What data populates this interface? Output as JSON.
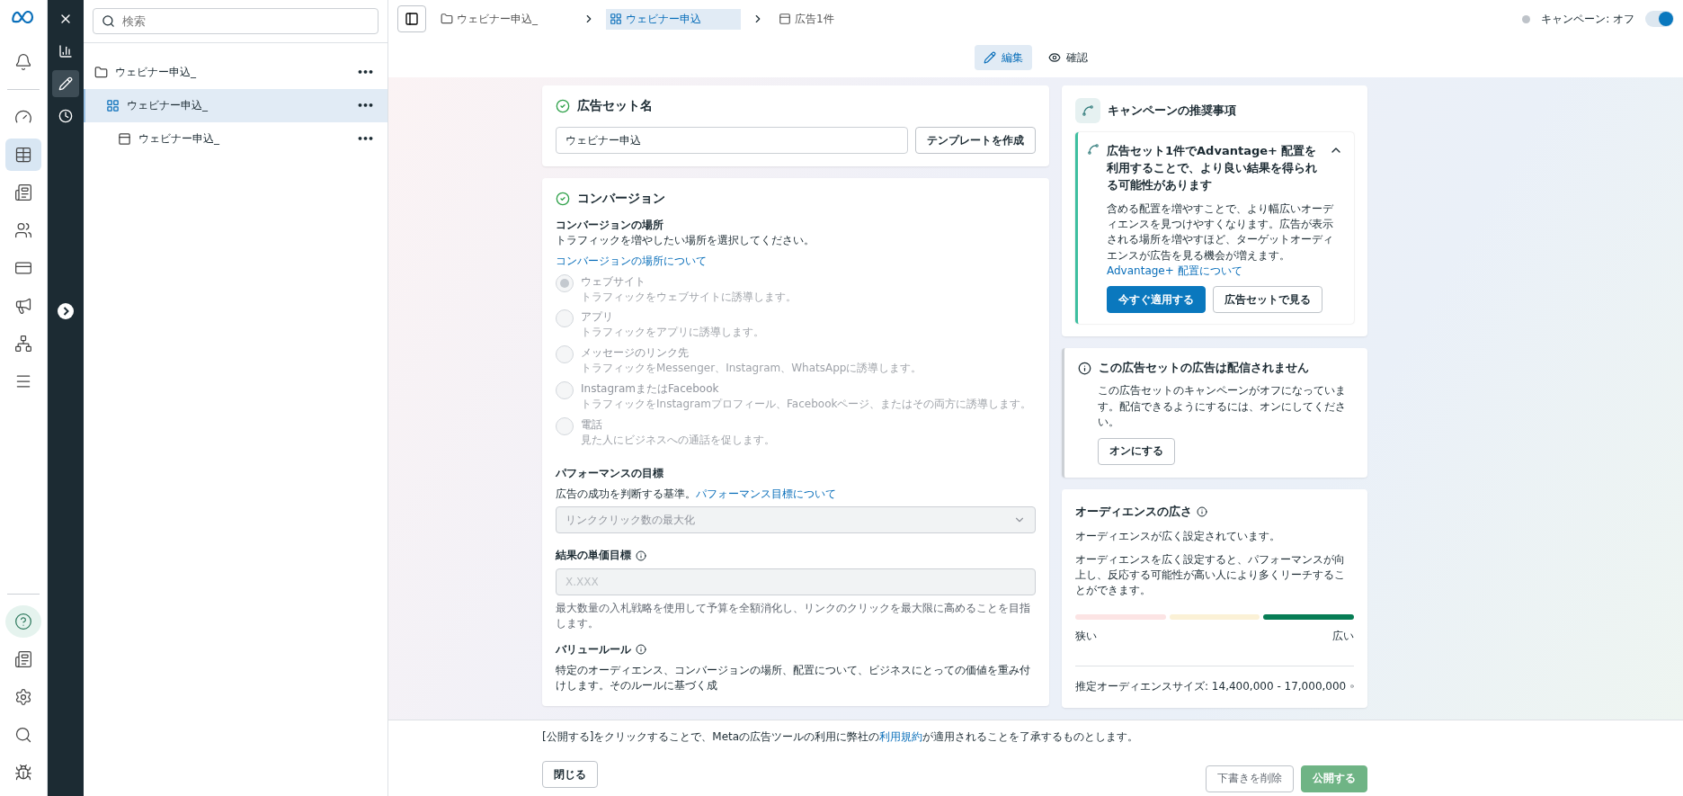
{
  "left_rail": {
    "main": [
      {
        "selected": false
      },
      {
        "selected": true
      },
      {
        "selected": false
      },
      {
        "selected": false
      },
      {
        "selected": false
      },
      {
        "selected": false
      },
      {
        "selected": false
      },
      {
        "selected": false
      }
    ],
    "bottom": [
      {
        "selected": true
      },
      {
        "selected": false
      },
      {
        "selected": false
      },
      {
        "selected": false
      },
      {
        "selected": false
      }
    ]
  },
  "tool_rail": [
    {
      "selected": false
    },
    {
      "selected": false
    },
    {
      "selected": true
    },
    {
      "selected": false
    }
  ],
  "tree": {
    "search": {
      "placeholder": "検索"
    },
    "items": [
      {
        "kind": "campaign",
        "label": "ウェビナー申込_",
        "more": "•••",
        "selected": false,
        "children": [
          {
            "kind": "adset",
            "label": "ウェビナー申込_",
            "more": "•••",
            "selected": true,
            "children": [
              {
                "kind": "ad",
                "label": "ウェビナー申込_",
                "more": "•••",
                "selected": false
              }
            ]
          }
        ]
      }
    ]
  },
  "breadcrumbs": [
    {
      "kind": "campaign",
      "label": "ウェビナー申込_",
      "selected": false
    },
    {
      "kind": "adset",
      "label": "ウェビナー申込",
      "selected": true
    },
    {
      "kind": "ad",
      "label": "広告1件",
      "selected": false
    }
  ],
  "campaign_toggle": {
    "label": "キャンペーン: オフ",
    "on": true
  },
  "tabs": [
    {
      "kind": "edit",
      "label": "編集",
      "selected": true
    },
    {
      "kind": "review",
      "label": "確認",
      "selected": false
    }
  ],
  "adset_name": {
    "title": "広告セット名",
    "value": "ウェビナー申込",
    "button": "テンプレートを作成"
  },
  "conversion": {
    "title": "コンバージョン",
    "location_title": "コンバージョンの場所",
    "location_hint": "トラフィックを増やしたい場所を選択してください。",
    "location_link": "コンバージョンの場所について",
    "options": [
      {
        "label": "ウェブサイト",
        "hint": "トラフィックをウェブサイトに誘導します。",
        "selected": true,
        "disabled": true
      },
      {
        "label": "アプリ",
        "hint": "トラフィックをアプリに誘導します。",
        "selected": false,
        "disabled": true
      },
      {
        "label": "メッセージのリンク先",
        "hint": "トラフィックをMessenger、Instagram、WhatsAppに誘導します。",
        "selected": false,
        "disabled": true
      },
      {
        "label": "InstagramまたはFacebook",
        "hint": "トラフィックをInstagramプロフィール、Facebookページ、またはその両方に誘導します。",
        "selected": false,
        "disabled": true
      },
      {
        "label": "電話",
        "hint": "見た人にビジネスへの通話を促します。",
        "selected": false,
        "disabled": true
      }
    ],
    "goal_title": "パフォーマンスの目標",
    "goal_hint": "広告の成功を判断する基準。",
    "goal_link": "パフォーマンス目標について",
    "goal_value": "リンククリック数の最大化",
    "cost_title": "結果の単価目標",
    "cost_placeholder": "X.XXX",
    "cost_hint": "最大数量の入札戦略を使用して予算を全額消化し、リンクのクリックを最大限に高めることを目指します。",
    "value_title": "バリュールール",
    "value_hint": "特定のオーディエンス、コンバージョンの場所、配置について、ビジネスにとっての価値を重み付けします。そのルールに基づく成"
  },
  "recommendations": {
    "title": "キャンペーンの推奨事項",
    "item": {
      "title": "広告セット1件でAdvantage+ 配置を利用することで、より良い結果を得られる可能性があります",
      "expanded": true,
      "body": "含める配置を増やすことで、より幅広いオーディエンスを見つけやすくなります。広告が表示される場所を増やすほど、ターゲットオーディエンスが広告を見る機会が増えます。",
      "link": "Advantage+ 配置について",
      "primary": "今すぐ適用する",
      "secondary": "広告セットで見る"
    }
  },
  "delivery_notice": {
    "title": "この広告セットの広告は配信されません",
    "body": "この広告セットのキャンペーンがオフになっています。配信できるようにするには、オンにしてください。",
    "button": "オンにする"
  },
  "audience": {
    "title": "オーディエンスの広さ",
    "status": "オーディエンスが広く設定されています。",
    "body": "オーディエンスを広く設定すると、パフォーマンスが向上し、反応する可能性が高い人により多くリーチすることができます。",
    "meter": [
      {
        "selected": false
      },
      {
        "selected": false
      },
      {
        "selected": true
      }
    ],
    "min_label": "狭い",
    "max_label": "広い",
    "size": "推定オーディエンスサイズ: 14,400,000 - 17,000,000"
  },
  "footer": {
    "notice_before": "[公開する]をクリックすることで、Metaの広告ツールの利用に弊社の",
    "notice_link": "利用規約",
    "notice_after": "が適用されることを了承するものとします。",
    "close": "閉じる",
    "delete_draft": "下書きを削除",
    "publish": "公開する",
    "publish_disabled": true
  }
}
